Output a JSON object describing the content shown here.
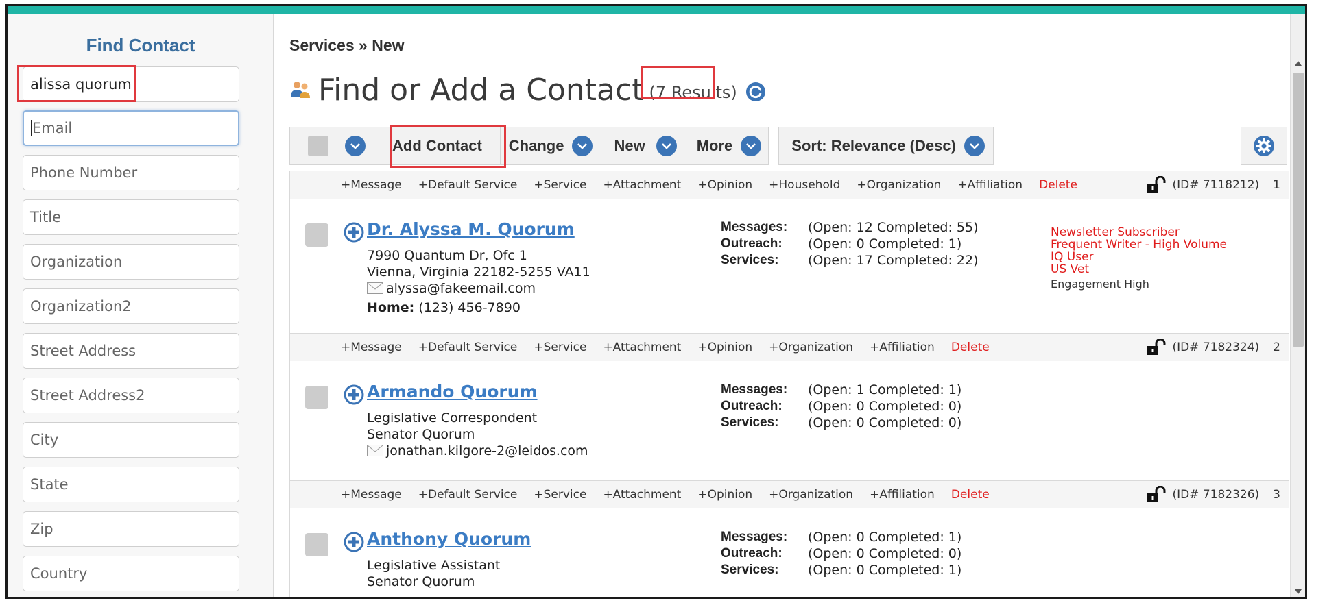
{
  "sidebar": {
    "title": "Find Contact",
    "search_value": "alissa quorum",
    "placeholders": {
      "email": "Email",
      "phone": "Phone Number",
      "title": "Title",
      "organization": "Organization",
      "organization2": "Organization2",
      "street": "Street Address",
      "street2": "Street Address2",
      "city": "City",
      "state": "State",
      "zip": "Zip",
      "country": "Country"
    }
  },
  "header": {
    "breadcrumb": "Services » New",
    "title": "Find or Add a Contact",
    "results": "(7 Results)"
  },
  "toolbar": {
    "add_contact": "Add Contact",
    "change": "Change",
    "new": "New",
    "more": "More",
    "sort": "Sort: Relevance (Desc)"
  },
  "labels": {
    "messages": "Messages:",
    "outreach": "Outreach:",
    "services": "Services:"
  },
  "records": [
    {
      "actions": [
        "+Message",
        "+Default Service",
        "+Service",
        "+Attachment",
        "+Opinion",
        "+Household",
        "+Organization",
        "+Affiliation"
      ],
      "delete": "Delete",
      "id": "(ID# 7118212)",
      "num": "1",
      "name": "Dr. Alyssa M. Quorum",
      "line1": "7990 Quantum Dr, Ofc 1",
      "line2": "Vienna, Virginia 22182-5255 VA11",
      "email": "alyssa@fakeemail.com",
      "home_label": "Home:",
      "home_phone": "(123) 456-7890",
      "messages": "(Open: 12 Completed: 55)",
      "outreach": "(Open: 0 Completed: 1)",
      "services": "(Open: 17 Completed: 22)",
      "tags": [
        "Newsletter Subscriber",
        "Frequent Writer - High Volume",
        "IQ User",
        "US Vet"
      ],
      "tag_extra": "Engagement High"
    },
    {
      "actions": [
        "+Message",
        "+Default Service",
        "+Service",
        "+Attachment",
        "+Opinion",
        "+Organization",
        "+Affiliation"
      ],
      "delete": "Delete",
      "id": "(ID# 7182324)",
      "num": "2",
      "name": "Armando Quorum",
      "line1": "Legislative Correspondent",
      "line2": "Senator Quorum",
      "email": "jonathan.kilgore-2@leidos.com",
      "messages": "(Open: 1 Completed: 1)",
      "outreach": "(Open: 0 Completed: 0)",
      "services": "(Open: 0 Completed: 0)"
    },
    {
      "actions": [
        "+Message",
        "+Default Service",
        "+Service",
        "+Attachment",
        "+Opinion",
        "+Organization",
        "+Affiliation"
      ],
      "delete": "Delete",
      "id": "(ID# 7182326)",
      "num": "3",
      "name": "Anthony Quorum",
      "line1": "Legislative Assistant",
      "line2": "Senator Quorum",
      "messages": "(Open: 0 Completed: 1)",
      "outreach": "(Open: 0 Completed: 0)",
      "services": "(Open: 0 Completed: 1)"
    }
  ],
  "colors": {
    "accent": "#1fb5a6",
    "link": "#3b7cc4",
    "highlight": "#e0393e",
    "tag": "#e01b1b"
  }
}
